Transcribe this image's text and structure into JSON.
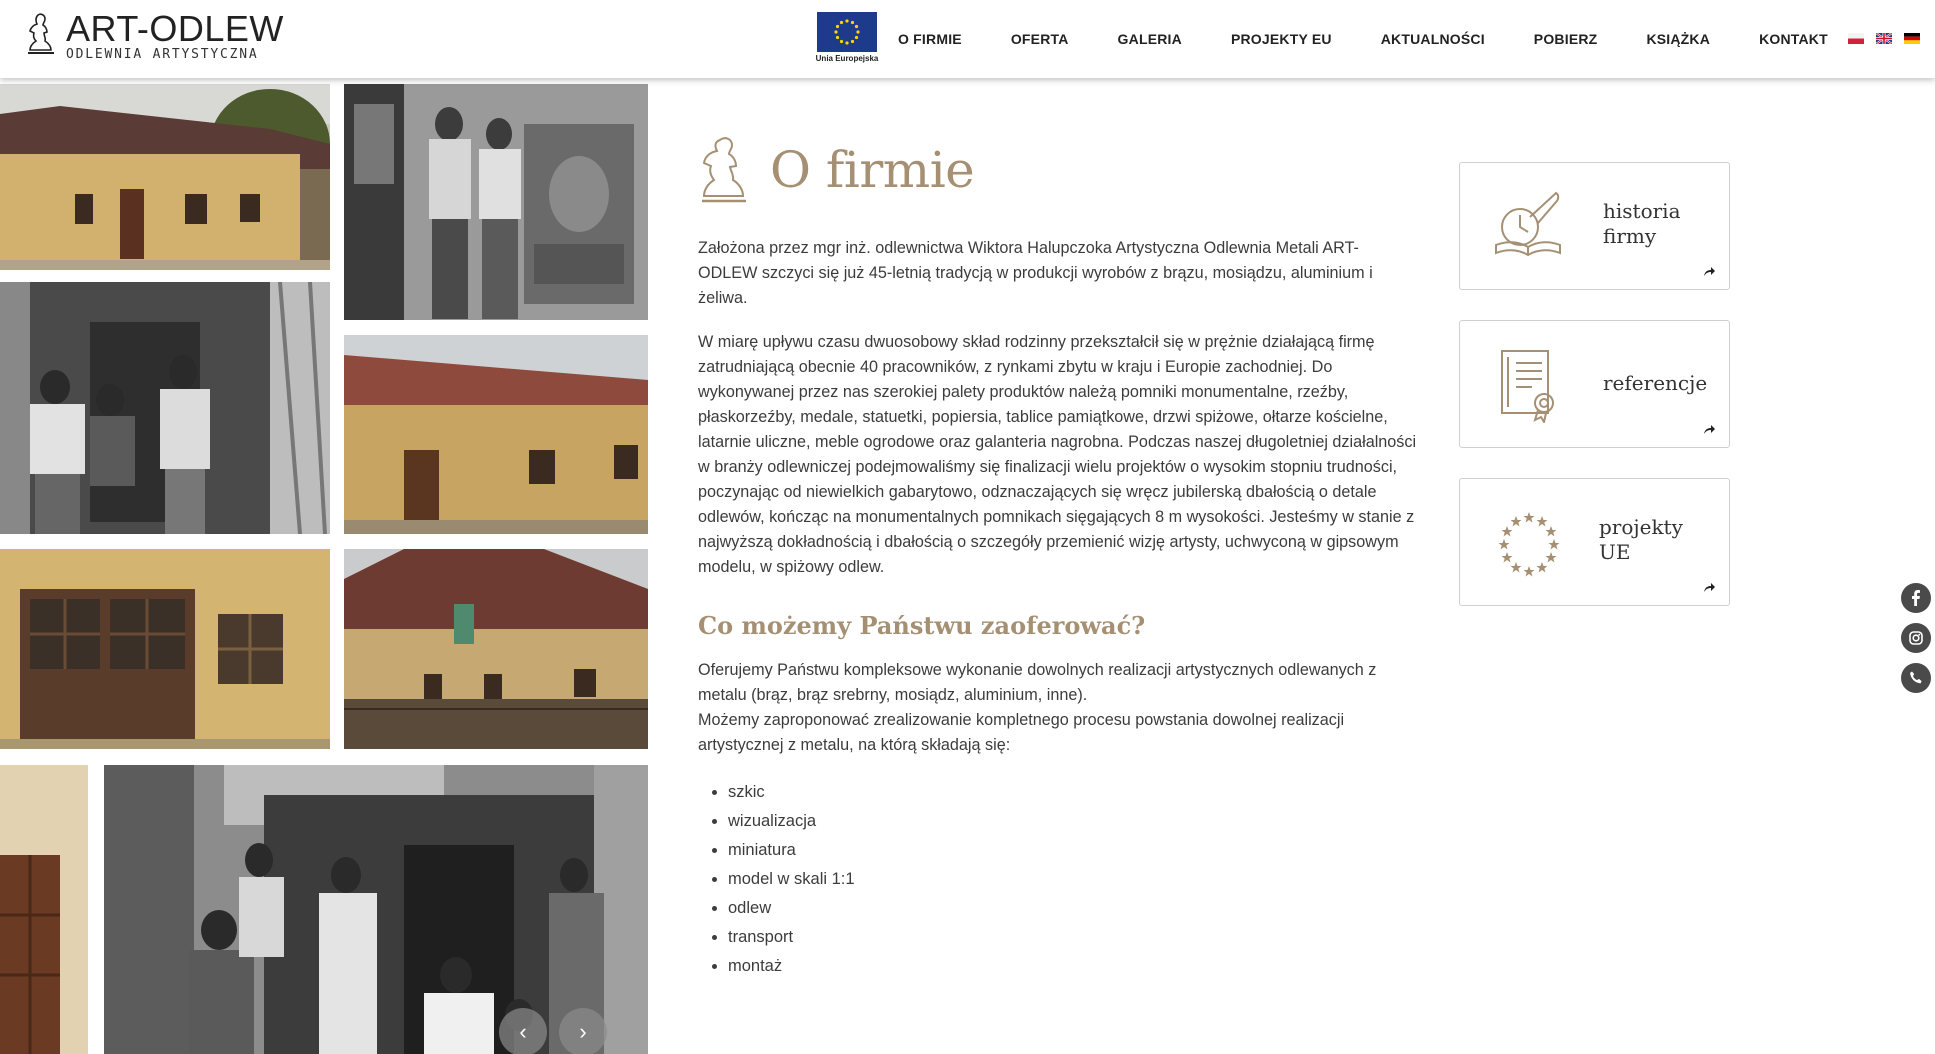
{
  "header": {
    "logo_name": "ART-ODLEW",
    "logo_sub": "ODLEWNIA ARTYSTYCZNA",
    "eu_caption": "Unia Europejska",
    "nav": [
      "O FIRMIE",
      "OFERTA",
      "GALERIA",
      "PROJEKTY EU",
      "AKTUALNOŚCI",
      "POBIERZ",
      "KSIĄŻKA",
      "KONTAKT"
    ],
    "languages": [
      "pl",
      "en",
      "de"
    ]
  },
  "gallery": {
    "prev_label": "‹",
    "next_label": "›"
  },
  "main": {
    "title": "O firmie",
    "intro": "Założona przez mgr inż. odlewnictwa Wiktora Halupczoka Artystyczna Odlewnia Metali ART- ODLEW szczyci się już 45-letnią tradycją w produkcji wyrobów z brązu, mosiądzu, aluminium i żeliwa.",
    "body": "W miarę upływu czasu dwuosobowy skład rodzinny przekształcił się w prężnie działającą firmę zatrudniającą obecnie 40 pracowników, z rynkami zbytu w kraju i Europie zachodniej. Do wykonywanej przez nas szerokiej palety produktów należą pomniki monumentalne, rzeźby, płaskorzeźby, medale, statuetki, popiersia, tablice pamiątkowe, drzwi spiżowe, ołtarze kościelne, latarnie uliczne, meble ogrodowe oraz galanteria nagrobna. Podczas naszej długoletniej działalności w branży odlewniczej podejmowaliśmy się finalizacji wielu projektów o wysokim stopniu trudności, poczynając od niewielkich gabarytowo, odznaczających się wręcz jubilerską dbałością o detale odlewów, kończąc na monumentalnych pomnikach sięgających 8 m wysokości. Jesteśmy w stanie z najwyższą dokładnością i dbałością o szczegóły przemienić wizję artysty, uchwyconą w gipsowym modelu, w spiżowy odlew.",
    "subtitle": "Co możemy Państwu zaoferować?",
    "offer_line1": "Oferujemy Państwu kompleksowe wykonanie dowolnych realizacji artystycznych odlewanych z metalu (brąz, brąz srebrny, mosiądz, aluminium, inne).",
    "offer_line2": "Możemy zaproponować zrealizowanie kompletnego procesu powstania dowolnej realizacji artystycznej z metalu, na którą składają się:",
    "steps": [
      "szkic",
      "wizualizacja",
      "miniatura",
      "model w skali 1:1",
      "odlew",
      "transport",
      "montaż"
    ]
  },
  "cards": [
    {
      "label_line1": "historia",
      "label_line2": "firmy",
      "icon": "history-book-icon"
    },
    {
      "label_line1": "referencje",
      "label_line2": "",
      "icon": "certificate-icon"
    },
    {
      "label_line1": "projekty",
      "label_line2": "UE",
      "icon": "eu-stars-icon"
    }
  ],
  "social": [
    "facebook-icon",
    "instagram-icon",
    "phone-icon"
  ],
  "colors": {
    "accent": "#a69074",
    "text": "#3c3c3c",
    "eu_blue": "#1e3a8a",
    "eu_yellow": "#ffd400"
  }
}
